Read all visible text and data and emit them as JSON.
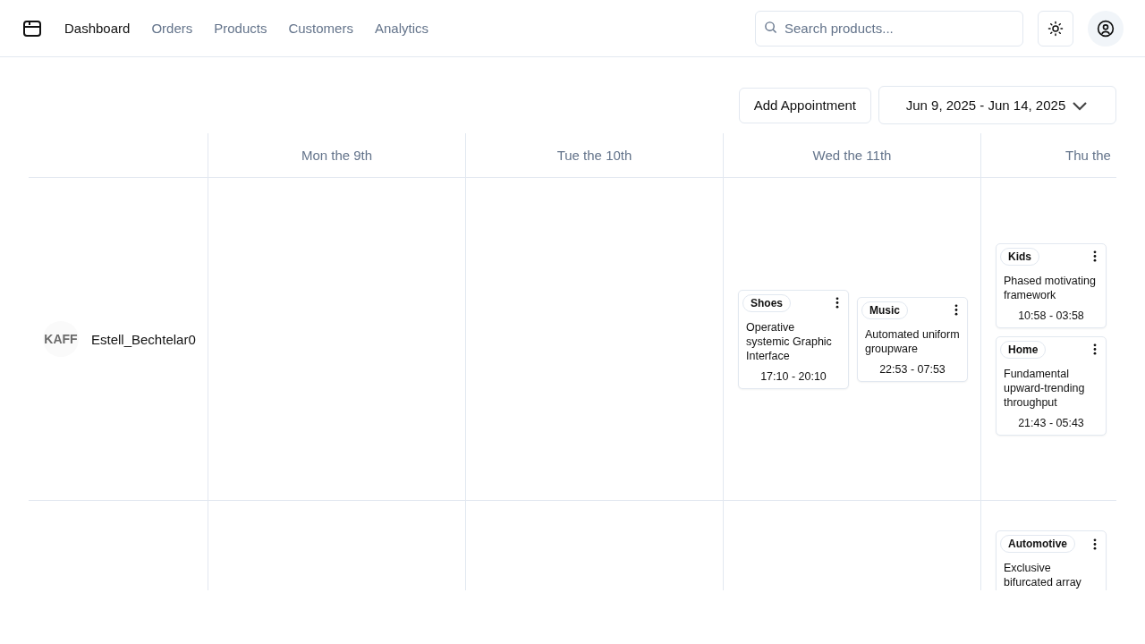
{
  "nav": {
    "items": [
      {
        "label": "Dashboard",
        "selected": true
      },
      {
        "label": "Orders",
        "selected": false
      },
      {
        "label": "Products",
        "selected": false
      },
      {
        "label": "Customers",
        "selected": false
      },
      {
        "label": "Analytics",
        "selected": false
      }
    ],
    "search": {
      "placeholder": "Search products..."
    }
  },
  "toolbar": {
    "add_button": "Add Appointment",
    "date_range": "Jun 9, 2025 - Jun 14, 2025"
  },
  "calendar": {
    "days": [
      "Mon the 9th",
      "Tue the 10th",
      "Wed the 11th",
      "Thu the"
    ],
    "rows": [
      {
        "logo_text": "KAFF",
        "name": "Estell_Bechtelar0",
        "cells": [
          [],
          [],
          [
            [
              {
                "tag": "Shoes",
                "title": "Operative systemic Graphic Interface",
                "time": "17:10 - 20:10"
              }
            ],
            [
              {
                "tag": "Music",
                "title": "Automated uniform groupware",
                "time": "22:53 - 07:53"
              }
            ]
          ],
          [
            [
              {
                "tag": "Kids",
                "title": "Phased motivating framework",
                "time": "10:58 - 03:58"
              },
              {
                "tag": "Home",
                "title": "Fundamental upward-trending throughput",
                "time": "21:43 - 05:43"
              }
            ]
          ]
        ]
      },
      {
        "cells": [
          [],
          [],
          [],
          [
            [
              {
                "tag": "Automotive",
                "title": "Exclusive bifurcated array"
              }
            ]
          ]
        ]
      }
    ]
  }
}
